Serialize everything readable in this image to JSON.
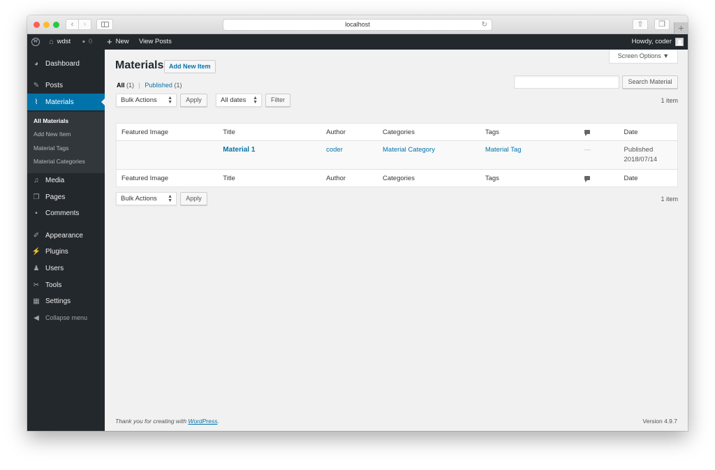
{
  "browser": {
    "address": "localhost",
    "back_icon": "chevron-left",
    "forward_icon": "chevron-right",
    "new_tab_label": "+"
  },
  "adminbar": {
    "site_name": "wdst",
    "comments_count": "0",
    "new_label": "New",
    "view_posts_label": "View Posts",
    "greeting": "Howdy, coder"
  },
  "menu": {
    "items": [
      {
        "label": "Dashboard",
        "icon": "dashboard-icon"
      },
      {
        "label": "Posts",
        "icon": "pin-icon"
      },
      {
        "label": "Materials",
        "icon": "paperclip-icon",
        "current": true
      },
      {
        "label": "Media",
        "icon": "media-icon"
      },
      {
        "label": "Pages",
        "icon": "pages-icon"
      },
      {
        "label": "Comments",
        "icon": "comment-icon"
      },
      {
        "label": "Appearance",
        "icon": "paintbrush-icon"
      },
      {
        "label": "Plugins",
        "icon": "plug-icon"
      },
      {
        "label": "Users",
        "icon": "user-icon"
      },
      {
        "label": "Tools",
        "icon": "wrench-icon"
      },
      {
        "label": "Settings",
        "icon": "settings-icon"
      }
    ],
    "submenu": [
      {
        "label": "All Materials",
        "current": true
      },
      {
        "label": "Add New Item"
      },
      {
        "label": "Material Tags"
      },
      {
        "label": "Material Categories"
      }
    ],
    "collapse_label": "Collapse menu"
  },
  "page": {
    "screen_options": "Screen Options ▼",
    "title": "Materials",
    "add_new": "Add New Item",
    "views": {
      "all_label": "All",
      "all_count": "(1)",
      "separator": "|",
      "published_label": "Published",
      "published_count": "(1)"
    },
    "search": {
      "value": "",
      "button": "Search Material"
    },
    "bulk_actions": "Bulk Actions",
    "apply": "Apply",
    "dates": "All dates",
    "filter": "Filter",
    "item_count": "1 item"
  },
  "table": {
    "columns": [
      "Featured Image",
      "Title",
      "Author",
      "Categories",
      "Tags",
      "",
      "Date"
    ],
    "rows": [
      {
        "featured_image": "",
        "title": "Material 1",
        "author": "coder",
        "categories": "Material Category",
        "tags": "Material Tag",
        "comments": "—",
        "date_status": "Published",
        "date": "2018/07/14"
      }
    ]
  },
  "footer": {
    "thanks_prefix": "Thank you for creating with ",
    "thanks_link": "WordPress",
    "thanks_suffix": ".",
    "version": "Version 4.9.7"
  }
}
